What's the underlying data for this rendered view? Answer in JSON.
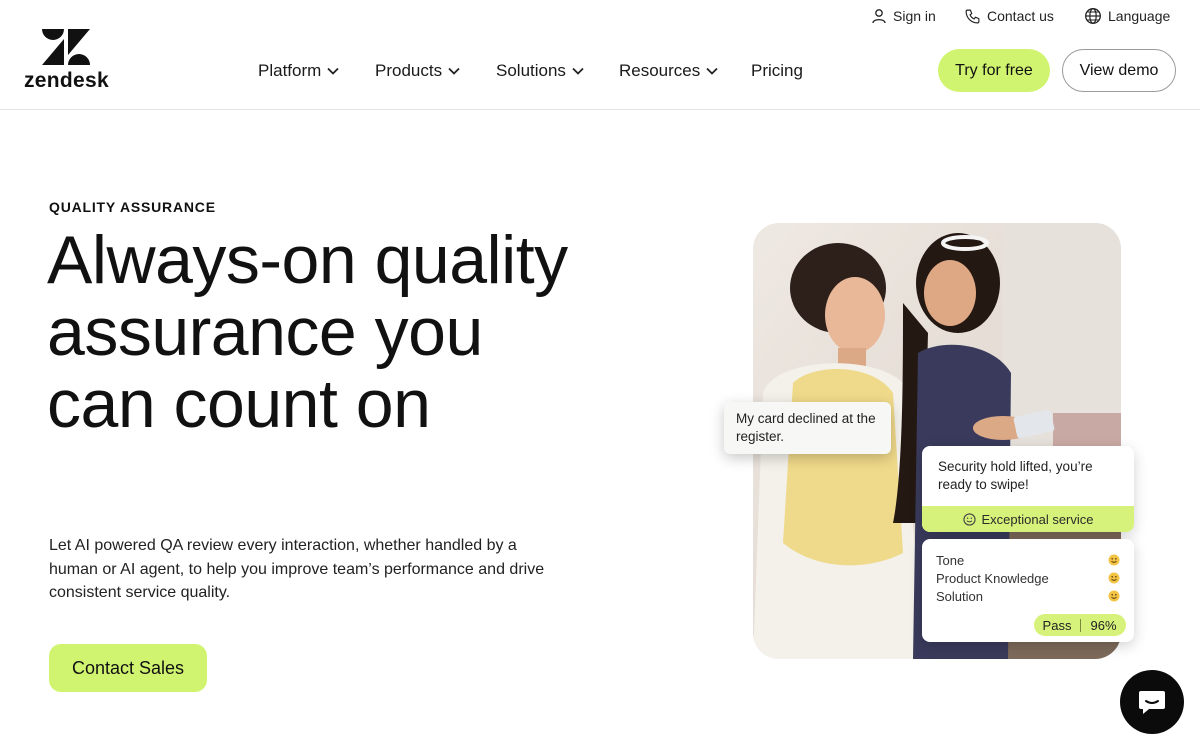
{
  "header": {
    "logo_text": "zendesk",
    "utility": {
      "sign_in": "Sign in",
      "contact_us": "Contact us",
      "language": "Language"
    },
    "nav": [
      {
        "label": "Platform",
        "has_dropdown": true
      },
      {
        "label": "Products",
        "has_dropdown": true
      },
      {
        "label": "Solutions",
        "has_dropdown": true
      },
      {
        "label": "Resources",
        "has_dropdown": true
      },
      {
        "label": "Pricing",
        "has_dropdown": false
      }
    ],
    "try_free_label": "Try for free",
    "view_demo_label": "View demo"
  },
  "hero": {
    "eyebrow": "QUALITY ASSURANCE",
    "headline": "Always-on quality assurance you can count on",
    "description": "Let AI powered QA review every interaction, whether handled by a human or AI agent, to help you improve team’s performance and drive consistent service quality.",
    "cta_label": "Contact Sales"
  },
  "illustration": {
    "customer_message": "My card declined at the register.",
    "agent_message": "Security hold lifted, you’re ready to swipe!",
    "service_tag": "Exceptional service",
    "scores": [
      {
        "label": "Tone",
        "icon": "smiley-icon"
      },
      {
        "label": "Product Knowledge",
        "icon": "smiley-icon"
      },
      {
        "label": "Solution",
        "icon": "smiley-icon"
      }
    ],
    "result_label": "Pass",
    "result_score": "96%"
  },
  "colors": {
    "accent": "#d1f470",
    "text": "#111111",
    "chat_button": "#0b0b0b",
    "border": "#e4e4e4"
  }
}
